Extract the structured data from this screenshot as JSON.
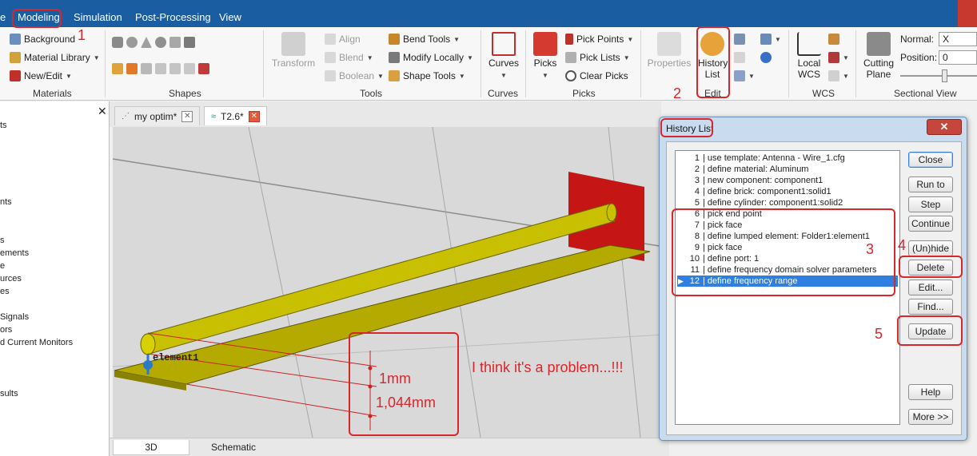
{
  "menu": {
    "items": [
      "Modeling",
      "Simulation",
      "Post-Processing",
      "View"
    ],
    "partial_left": "e"
  },
  "ribbon": {
    "materials": {
      "background": "Background",
      "library": "Material Library",
      "new_edit": "New/Edit",
      "label": "Materials"
    },
    "shapes": {
      "label": "Shapes"
    },
    "tools": {
      "transform": "Transform",
      "align": "Align",
      "blend": "Blend",
      "boolean": "Boolean",
      "bend_tools": "Bend Tools",
      "modify_locally": "Modify Locally",
      "shape_tools": "Shape Tools",
      "label": "Tools"
    },
    "curves": {
      "button": "Curves",
      "label": "Curves"
    },
    "picks": {
      "button": "Picks",
      "pick_points": "Pick Points",
      "pick_lists": "Pick Lists",
      "clear_picks": "Clear Picks",
      "label": "Picks"
    },
    "edit": {
      "properties": "Properties",
      "history_list": "History List",
      "label": "Edit"
    },
    "wcs": {
      "local": "Local WCS",
      "label": "WCS"
    },
    "sectional": {
      "cutting_plane": "Cutting Plane",
      "normal_label": "Normal:",
      "normal_value": "X",
      "position_label": "Position:",
      "position_value": "0",
      "label": "Sectional View"
    }
  },
  "left_panel": {
    "items": [
      "ts",
      "nts",
      "s",
      "ements",
      "e",
      "urces",
      "es",
      "Signals",
      "ors",
      "d Current Monitors",
      "sults"
    ]
  },
  "tabs": [
    {
      "label": "my optim*"
    },
    {
      "label": "T2.6*"
    }
  ],
  "viewport": {
    "element_label": "element1"
  },
  "bottom_tabs": [
    "3D",
    "Schematic"
  ],
  "history": {
    "title": "History List",
    "rows": [
      {
        "n": "1",
        "text": "| use template: Antenna - Wire_1.cfg"
      },
      {
        "n": "2",
        "text": "| define material: Aluminum"
      },
      {
        "n": "3",
        "text": "| new component: component1"
      },
      {
        "n": "4",
        "text": "| define brick: component1:solid1"
      },
      {
        "n": "5",
        "text": "| define cylinder: component1:solid2"
      },
      {
        "n": "6",
        "text": "| pick end point"
      },
      {
        "n": "7",
        "text": "| pick face"
      },
      {
        "n": "8",
        "text": "| define lumped element: Folder1:element1"
      },
      {
        "n": "9",
        "text": "| pick face"
      },
      {
        "n": "10",
        "text": "| define port: 1"
      },
      {
        "n": "11",
        "text": "| define frequency domain solver parameters"
      },
      {
        "n": "12",
        "text": "| define frequency range"
      }
    ],
    "buttons": [
      "Close",
      "Run to",
      "Step",
      "Continue",
      "(Un)hide",
      "Delete",
      "Edit...",
      "Find...",
      "Update",
      "Help",
      "More >>"
    ]
  },
  "annotations": {
    "n1": "1",
    "n2": "2",
    "n3": "3",
    "n4": "4",
    "n5": "5",
    "dim1": "1mm",
    "dim2": "1,044mm",
    "comment": "I think it's a problem...!!!"
  },
  "colors": {
    "menubar": "#1a5da0",
    "annotation": "#d7262c",
    "selection": "#2f7fe0",
    "cylinder": "#c8c000",
    "port": "#cc1111"
  }
}
